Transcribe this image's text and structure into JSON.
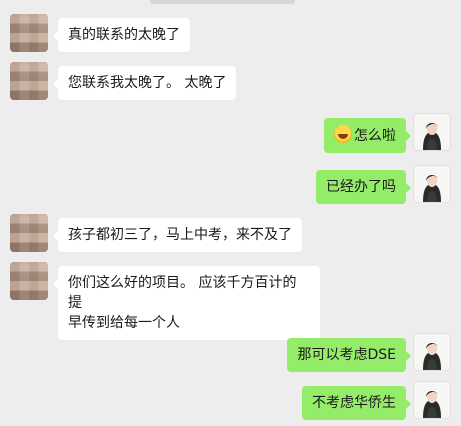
{
  "messages": [
    {
      "side": "in",
      "text": "真的联系的太晚了"
    },
    {
      "side": "in",
      "text": "您联系我太晚了。 太晚了"
    },
    {
      "side": "out",
      "emoji": "grinning-sweat-emoji",
      "text": "怎么啦"
    },
    {
      "side": "out",
      "text": "已经办了吗"
    },
    {
      "side": "in",
      "text": "孩子都初三了，马上中考，来不及了"
    },
    {
      "side": "in",
      "lines": [
        "你们这么好的项目。 应该千方百计的提",
        "早传到给每一个人"
      ]
    },
    {
      "side": "out",
      "text": "那可以考虑DSE"
    },
    {
      "side": "out",
      "text": "不考虑华侨生"
    }
  ],
  "colors": {
    "background": "#ededed",
    "incoming_bubble": "#ffffff",
    "outgoing_bubble": "#95ec69"
  }
}
